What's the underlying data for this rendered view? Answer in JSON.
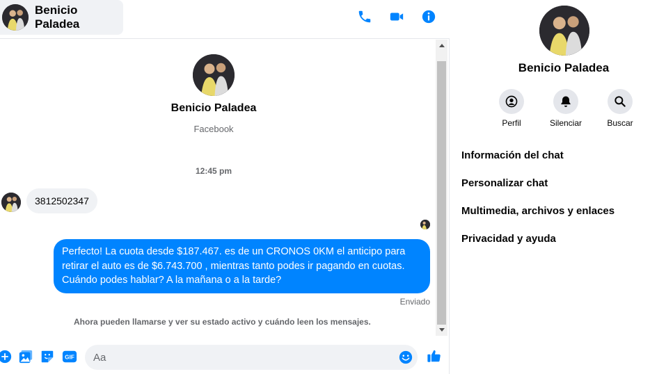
{
  "contact": {
    "name": "Benicio Paladea",
    "source": "Facebook"
  },
  "header": {
    "actions": [
      {
        "name": "phone-icon"
      },
      {
        "name": "video-camera-icon"
      },
      {
        "name": "info-icon"
      }
    ]
  },
  "conversation": {
    "timestamp": "12:45 pm",
    "incoming_message": "3812502347",
    "outgoing_message": "Perfecto! La cuota desde $187.467. es de un CRONOS 0KM el anticipo para retirar el auto es de $6.743.700 , mientras tanto podes ir pagando en cuotas. Cuándo podes hablar? A la mañana o a la tarde?",
    "sent_status": "Enviado",
    "notice": "Ahora pueden llamarse y ver su estado activo y cuándo leen los mensajes."
  },
  "composer": {
    "placeholder": "Aa",
    "icons": [
      "plus-circle-icon",
      "image-icon",
      "sticker-icon",
      "gif-icon",
      "emoji-icon",
      "thumbs-up-icon"
    ],
    "gif_label": "GIF"
  },
  "sidebar": {
    "actions": [
      {
        "label": "Perfil",
        "icon": "profile-icon"
      },
      {
        "label": "Silenciar",
        "icon": "bell-icon"
      },
      {
        "label": "Buscar",
        "icon": "search-icon"
      }
    ],
    "menu": [
      {
        "label": "Información del chat"
      },
      {
        "label": "Personalizar chat"
      },
      {
        "label": "Multimedia, archivos y enlaces"
      },
      {
        "label": "Privacidad y ayuda"
      }
    ]
  },
  "colors": {
    "accent": "#0084ff",
    "bubble_gray": "#f0f2f5",
    "muted_text": "#65676b"
  }
}
